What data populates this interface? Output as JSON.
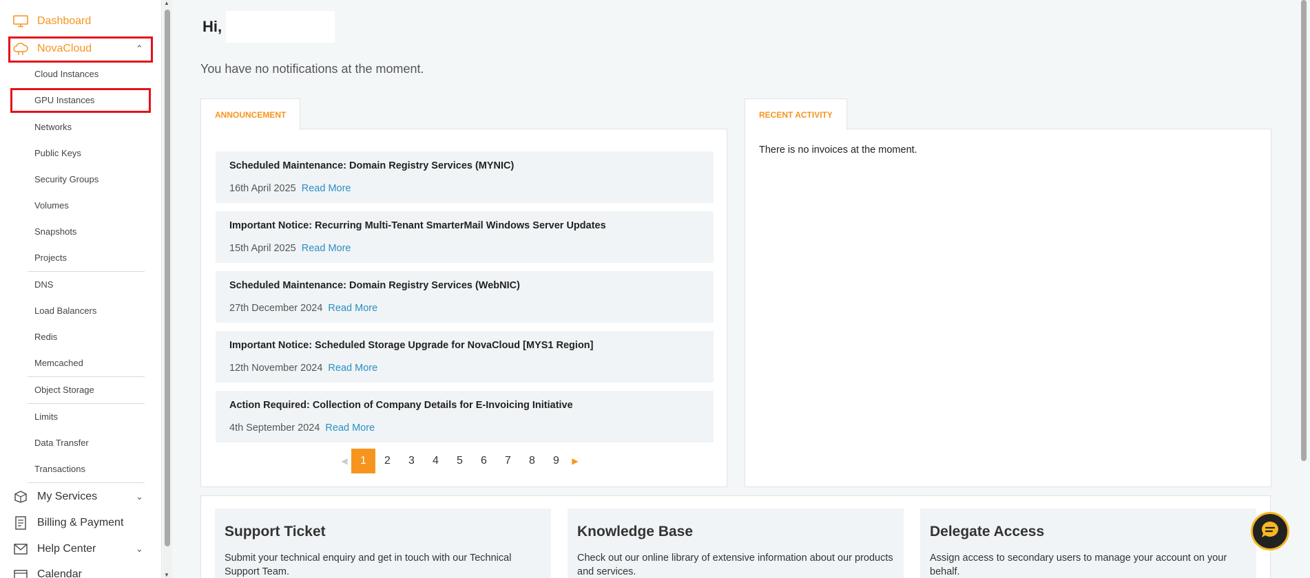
{
  "sidebar": {
    "dashboard": "Dashboard",
    "novacloud": "NovaCloud",
    "sub_items": [
      "Cloud Instances",
      "GPU Instances",
      "Networks",
      "Public Keys",
      "Security Groups",
      "Volumes",
      "Snapshots",
      "Projects",
      "DNS",
      "Load Balancers",
      "Redis",
      "Memcached",
      "Object Storage",
      "Limits",
      "Data Transfer",
      "Transactions"
    ],
    "my_services": "My Services",
    "billing": "Billing & Payment",
    "help_center": "Help Center",
    "calendar": "Calendar"
  },
  "greeting": {
    "hi": "Hi,",
    "notifications": "You have no notifications at the moment."
  },
  "announcement": {
    "tab": "ANNOUNCEMENT",
    "read_more": "Read More",
    "items": [
      {
        "title": "Scheduled Maintenance: Domain Registry Services (MYNIC)",
        "date": "16th April 2025"
      },
      {
        "title": "Important Notice: Recurring Multi-Tenant SmarterMail Windows Server Updates",
        "date": "15th April 2025"
      },
      {
        "title": "Scheduled Maintenance: Domain Registry Services (WebNIC)",
        "date": "27th December 2024"
      },
      {
        "title": "Important Notice: Scheduled Storage Upgrade for NovaCloud [MYS1 Region]",
        "date": "12th November 2024"
      },
      {
        "title": "Action Required: Collection of Company Details for E-Invoicing Initiative",
        "date": "4th September 2024"
      }
    ],
    "pages": [
      "1",
      "2",
      "3",
      "4",
      "5",
      "6",
      "7",
      "8",
      "9"
    ],
    "current_page": "1"
  },
  "recent_activity": {
    "tab": "RECENT ACTIVITY",
    "empty": "There is no invoices at the moment."
  },
  "cards": [
    {
      "title": "Support Ticket",
      "desc": "Submit your technical enquiry and get in touch with our Technical Support Team."
    },
    {
      "title": "Knowledge Base",
      "desc": "Check out our online library of extensive information about our products and services."
    },
    {
      "title": "Delegate Access",
      "desc": "Assign access to secondary users to manage your account on your behalf."
    }
  ],
  "colors": {
    "accent": "#f7941d",
    "highlight": "#e3121b",
    "link": "#2b8fc4"
  }
}
